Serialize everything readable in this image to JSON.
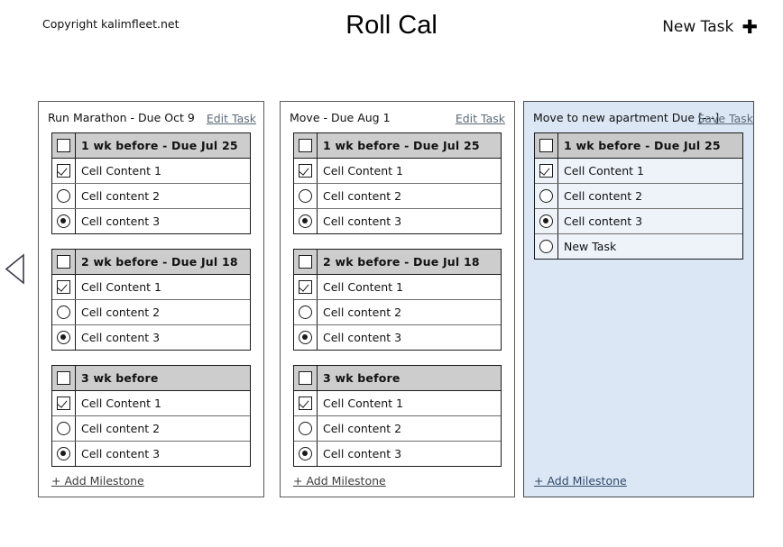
{
  "header": {
    "copyright": "Copyright kalimfleet.net",
    "title": "Roll Cal",
    "new_task_label": "New Task",
    "new_task_icon": "plus-icon",
    "nav_prev_icon": "triangle-left-icon"
  },
  "colors": {
    "card_border": "#5a5a5a",
    "milestone_header_bg": "#cdcdcd",
    "selected_card_bg": "#dce7f5",
    "selected_row_bg": "#eef3fa",
    "link": "#5d6b7a",
    "text": "#111111"
  },
  "add_milestone_label": "+ Add Milestone",
  "cards": [
    {
      "id": "run-marathon",
      "title": "Run Marathon - Due Oct 9",
      "action_label": "Edit Task",
      "selected": false,
      "milestones": [
        {
          "header": "1 wk before - Due Jul 25",
          "header_control": "checkbox-unchecked",
          "rows": [
            {
              "label": "Cell Content 1",
              "control": "checkbox-checked"
            },
            {
              "label": "Cell content 2",
              "control": "radio-unchecked"
            },
            {
              "label": "Cell content 3",
              "control": "radio-checked"
            }
          ]
        },
        {
          "header": "2 wk before - Due Jul 18",
          "header_control": "checkbox-unchecked",
          "rows": [
            {
              "label": "Cell Content 1",
              "control": "checkbox-checked"
            },
            {
              "label": "Cell content 2",
              "control": "radio-unchecked"
            },
            {
              "label": "Cell content 3",
              "control": "radio-checked"
            }
          ]
        },
        {
          "header": "3 wk before",
          "header_control": "checkbox-unchecked",
          "rows": [
            {
              "label": "Cell Content 1",
              "control": "checkbox-checked"
            },
            {
              "label": "Cell content 2",
              "control": "radio-unchecked"
            },
            {
              "label": "Cell content 3",
              "control": "radio-checked"
            }
          ]
        }
      ]
    },
    {
      "id": "move",
      "title": "Move - Due Aug 1",
      "action_label": "Edit Task",
      "selected": false,
      "milestones": [
        {
          "header": "1 wk before - Due Jul 25",
          "header_control": "checkbox-unchecked",
          "rows": [
            {
              "label": "Cell Content 1",
              "control": "checkbox-checked"
            },
            {
              "label": "Cell content 2",
              "control": "radio-unchecked"
            },
            {
              "label": "Cell content 3",
              "control": "radio-checked"
            }
          ]
        },
        {
          "header": "2 wk before - Due Jul 18",
          "header_control": "checkbox-unchecked",
          "rows": [
            {
              "label": "Cell Content 1",
              "control": "checkbox-checked"
            },
            {
              "label": "Cell content 2",
              "control": "radio-unchecked"
            },
            {
              "label": "Cell content 3",
              "control": "radio-checked"
            }
          ]
        },
        {
          "header": "3 wk before",
          "header_control": "checkbox-unchecked",
          "rows": [
            {
              "label": "Cell Content 1",
              "control": "checkbox-checked"
            },
            {
              "label": "Cell content 2",
              "control": "radio-unchecked"
            },
            {
              "label": "Cell content 3",
              "control": "radio-checked"
            }
          ]
        }
      ]
    },
    {
      "id": "move-to-new-apartment",
      "title": "Move to new apartment Due [---]",
      "action_label": "Save Task",
      "selected": true,
      "milestones": [
        {
          "header": "1 wk before - Due Jul 25",
          "header_control": "checkbox-unchecked",
          "rows": [
            {
              "label": "Cell Content 1",
              "control": "checkbox-checked"
            },
            {
              "label": "Cell content 2",
              "control": "radio-unchecked"
            },
            {
              "label": "Cell content 3",
              "control": "radio-checked"
            },
            {
              "label": "New Task",
              "control": "radio-unchecked"
            }
          ]
        }
      ]
    }
  ]
}
